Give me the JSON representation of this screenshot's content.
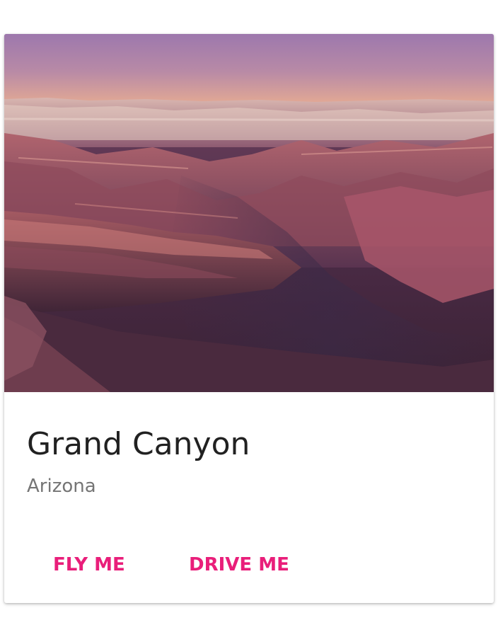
{
  "card": {
    "image_alt": "Grand Canyon",
    "title": "Grand Canyon",
    "subtitle": "Arizona",
    "actions": [
      {
        "label": "FLY ME"
      },
      {
        "label": "DRIVE ME"
      }
    ]
  },
  "colors": {
    "accent": "#e91e7a",
    "title_text": "#212121",
    "subtitle_text": "#757575",
    "card_background": "#ffffff"
  }
}
